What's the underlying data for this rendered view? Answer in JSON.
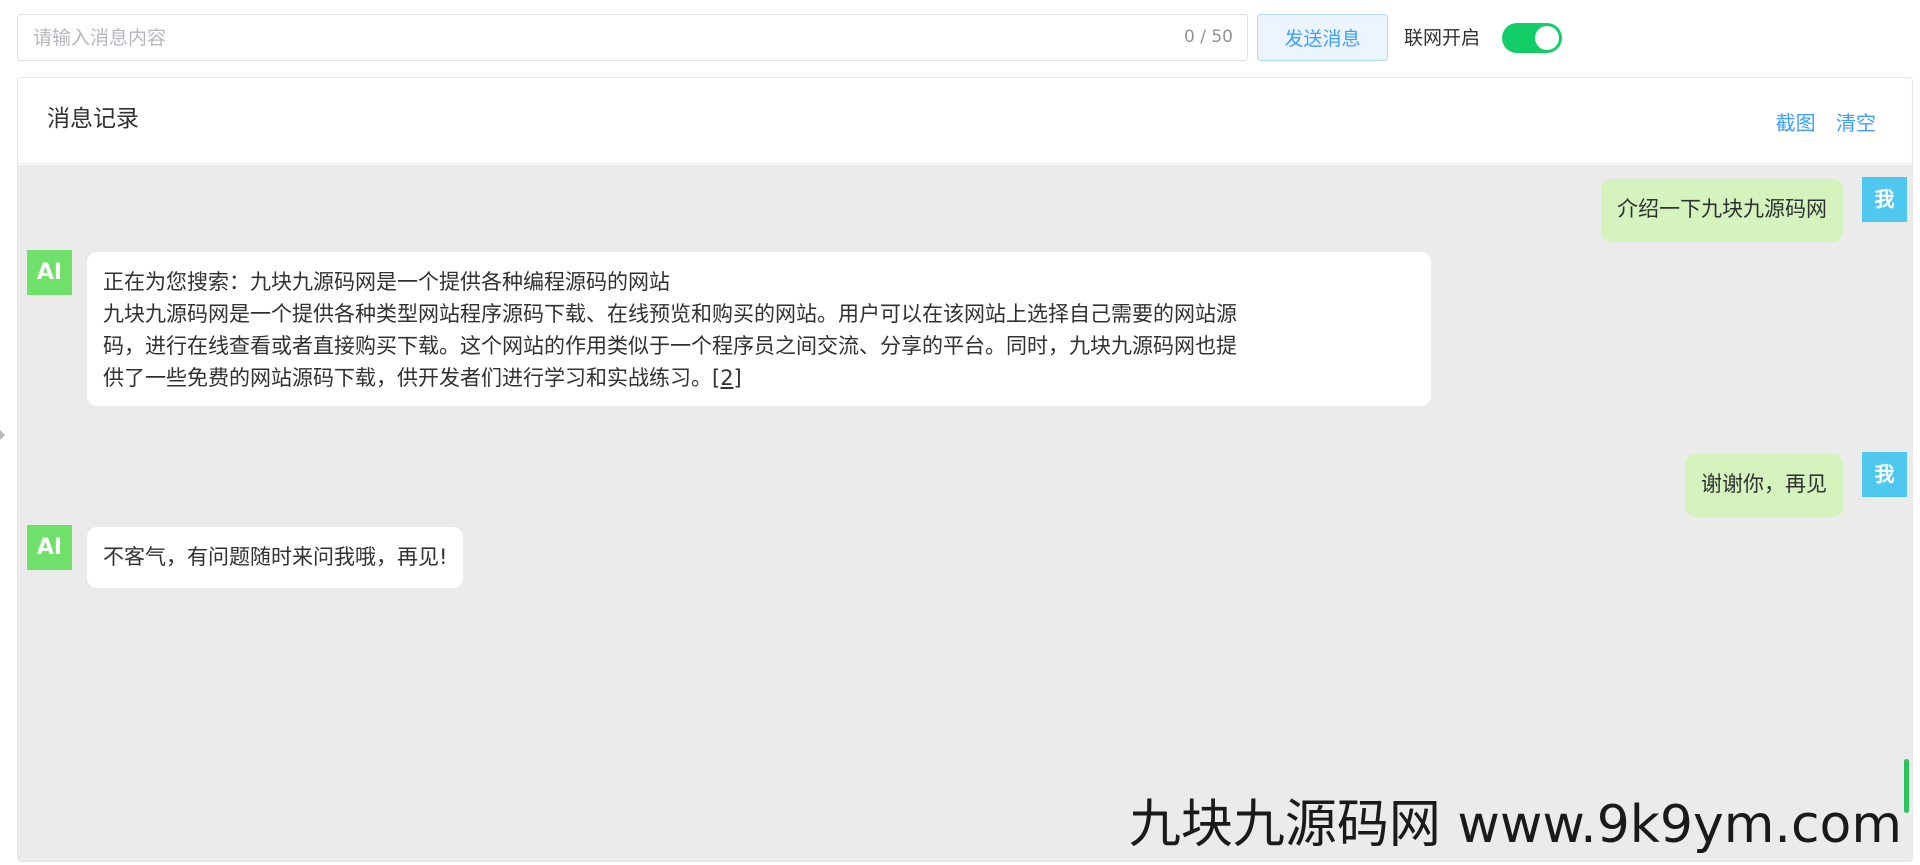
{
  "toolbar": {
    "input_placeholder": "请输入消息内容",
    "input_value": "",
    "char_count": "0 / 50",
    "send_label": "发送消息",
    "network_label": "联网开启",
    "network_enabled": true,
    "switch_color": "#13ce66"
  },
  "panel": {
    "title": "消息记录",
    "screenshot_label": "截图",
    "clear_label": "清空"
  },
  "avatars": {
    "ai": "AI",
    "me": "我"
  },
  "messages": [
    {
      "role": "user",
      "text": "介绍一下九块九源码网"
    },
    {
      "role": "ai",
      "lines": [
        "正在为您搜索：九块九源码网是一个提供各种编程源码的网站",
        "九块九源码网是一个提供各种类型网站程序源码下载、在线预览和购买的网站。用户可以在该网站上选择自己需要的网站源",
        "码，进行在线查看或者直接购买下载。这个网站的作用类似于一个程序员之间交流、分享的平台。同时，九块九源码网也提",
        "供了一些免费的网站源码下载，供开发者们进行学习和实战练习。"
      ],
      "reference": "[2]"
    },
    {
      "role": "user",
      "text": "谢谢你，再见"
    },
    {
      "role": "ai",
      "text": "不客气，有问题随时来问我哦，再见!"
    }
  ],
  "watermark": "九块九源码网 www.9k9ym.com",
  "colors": {
    "user_bubble": "#d5f4bd",
    "ai_avatar": "#6fe06a",
    "me_avatar": "#4fc8ef",
    "link": "#409eff",
    "chat_background": "#ebebeb"
  }
}
